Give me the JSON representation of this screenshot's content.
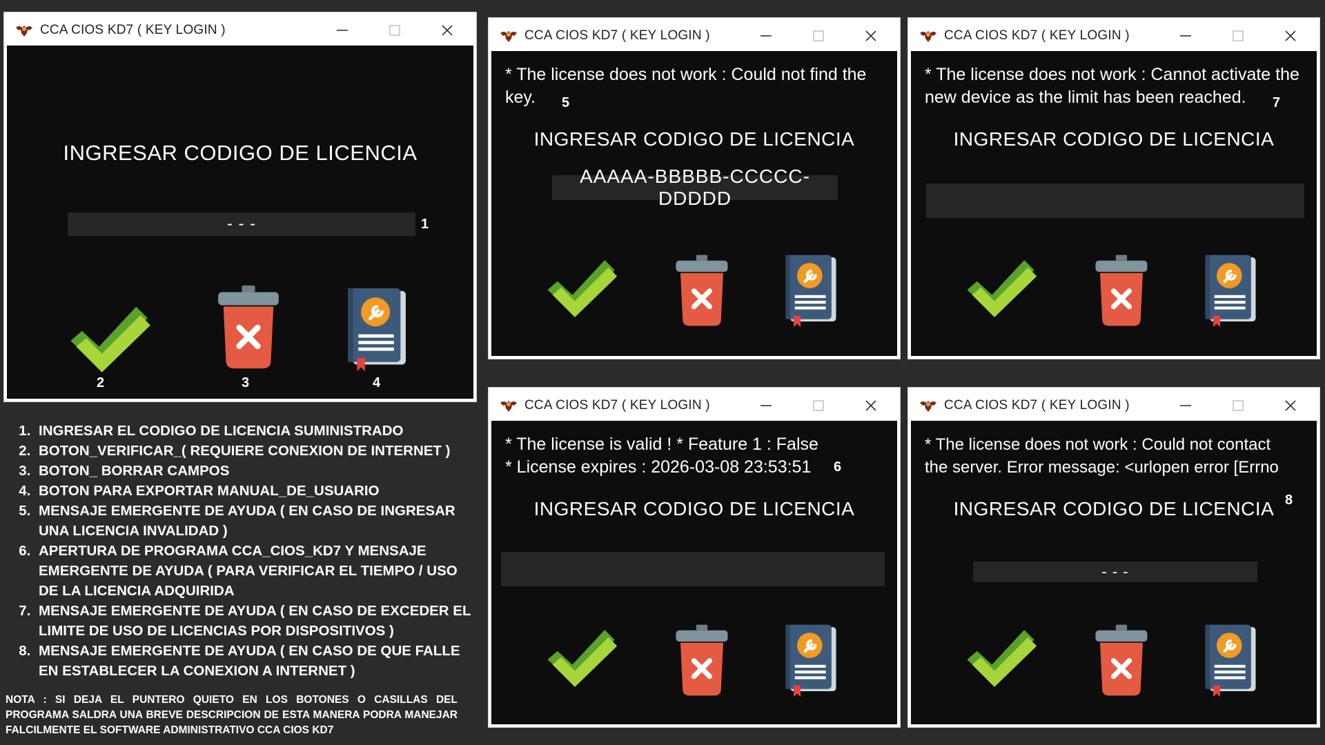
{
  "window_title": "CCA CIOS KD7 ( KEY LOGIN )",
  "heading": "INGRESAR CODIGO DE LICENCIA",
  "windows": [
    {
      "message": "",
      "field_value": "-     -     -",
      "number": "1"
    },
    {
      "message": "* The license does not work : Could not find the\nkey.",
      "field_value": "AAAAA-BBBBB-CCCCC-DDDDD",
      "number": "5"
    },
    {
      "message": "* The license does not work : Cannot activate the\nnew device as the limit has been reached.",
      "field_value": "",
      "number": "7"
    },
    {
      "message": "* The license is valid ! * Feature 1 : False\n* License expires : 2026-03-08 23:53:51",
      "field_value": "",
      "number": "6"
    },
    {
      "message": "* The license does not work : Could not contact\nthe server. Error message: <urlopen error [Errno",
      "field_value": "-     -     -",
      "number": "8"
    }
  ],
  "button_numbers": [
    "2",
    "3",
    "4"
  ],
  "legend": [
    "INGRESAR EL CODIGO DE LICENCIA SUMINISTRADO",
    "BOTON_VERIFICAR_( REQUIERE CONEXION DE INTERNET )",
    "BOTON_ BORRAR CAMPOS",
    "BOTON PARA EXPORTAR MANUAL_DE_USUARIO",
    "MENSAJE EMERGENTE DE AYUDA ( EN CASO DE INGRESAR UNA LICENCIA INVALIDAD )",
    "APERTURA DE PROGRAMA CCA_CIOS_KD7 Y MENSAJE EMERGENTE DE AYUDA ( PARA VERIFICAR EL TIEMPO / USO DE LA LICENCIA ADQUIRIDA",
    "MENSAJE EMERGENTE DE AYUDA ( EN CASO DE EXCEDER EL LIMITE DE USO DE LICENCIAS POR DISPOSITIVOS )",
    "MENSAJE EMERGENTE DE AYUDA ( EN CASO DE QUE FALLE EN ESTABLECER LA CONEXION A INTERNET )"
  ],
  "nota": "NOTA : SI DEJA EL PUNTERO QUIETO EN LOS BOTONES O CASILLAS DEL PROGRAMA SALDRA UNA BREVE DESCRIPCION DE ESTA MANERA PODRA MANEJAR FALCILMENTE EL SOFTWARE ADMINISTRATIVO CCA CIOS KD7",
  "icons": {
    "app_logo": "eagle-emblem-icon",
    "minimize": "minimize-icon",
    "maximize": "maximize-icon",
    "close": "close-icon",
    "verify": "checkmark-icon",
    "clear": "trash-icon",
    "manual": "manual-book-icon"
  },
  "colors": {
    "check_light": "#a6d63a",
    "check_dark": "#5aa22c",
    "trash_body": "#e55a43",
    "trash_lid": "#7f949c",
    "book_cover": "#3e5a7a",
    "book_badge": "#f29b24",
    "bookmark": "#e8423f"
  }
}
